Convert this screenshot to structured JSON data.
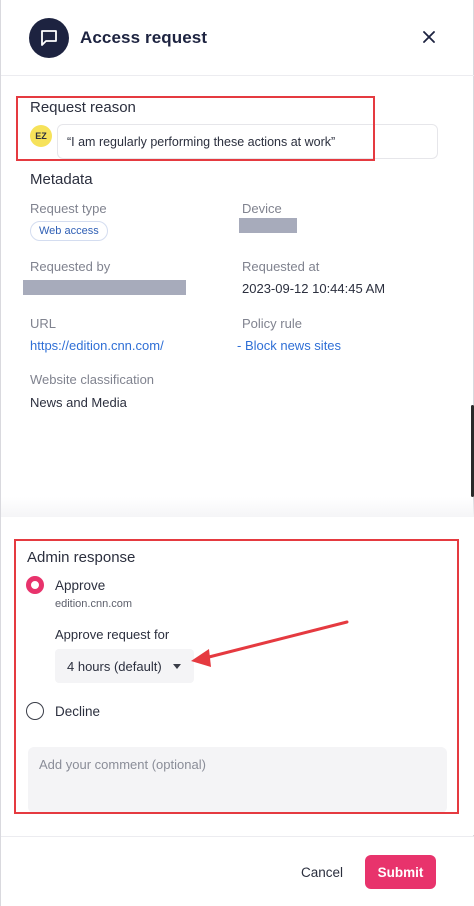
{
  "header": {
    "title": "Access request",
    "icon": "chat-bubble-icon",
    "close_icon": "close-icon"
  },
  "request": {
    "reason_label": "Request reason",
    "avatar_initials": "EZ",
    "reason_text": "“I am regularly performing these actions at work”"
  },
  "metadata": {
    "label": "Metadata",
    "request_type_label": "Request type",
    "request_type_value": "Web access",
    "device_label": "Device",
    "requested_by_label": "Requested by",
    "requested_at_label": "Requested at",
    "requested_at_value": "2023-09-12 10:44:45 AM",
    "url_label": "URL",
    "url_value": "https://edition.cnn.com/",
    "policy_rule_label": "Policy rule",
    "policy_rule_value": "- Block news sites",
    "classification_label": "Website classification",
    "classification_value": "News and Media"
  },
  "admin": {
    "label": "Admin response",
    "approve_label": "Approve",
    "approve_domain": "edition.cnn.com",
    "approve_for_label": "Approve request for",
    "approve_for_value": "4 hours (default)",
    "decline_label": "Decline",
    "comment_placeholder": "Add your comment (optional)",
    "selected": "approve"
  },
  "footer": {
    "cancel_label": "Cancel",
    "submit_label": "Submit"
  },
  "colors": {
    "accent": "#e8336c",
    "header_icon_bg": "#1d2340",
    "link": "#2f6fd6",
    "annotation": "#e53a40"
  }
}
